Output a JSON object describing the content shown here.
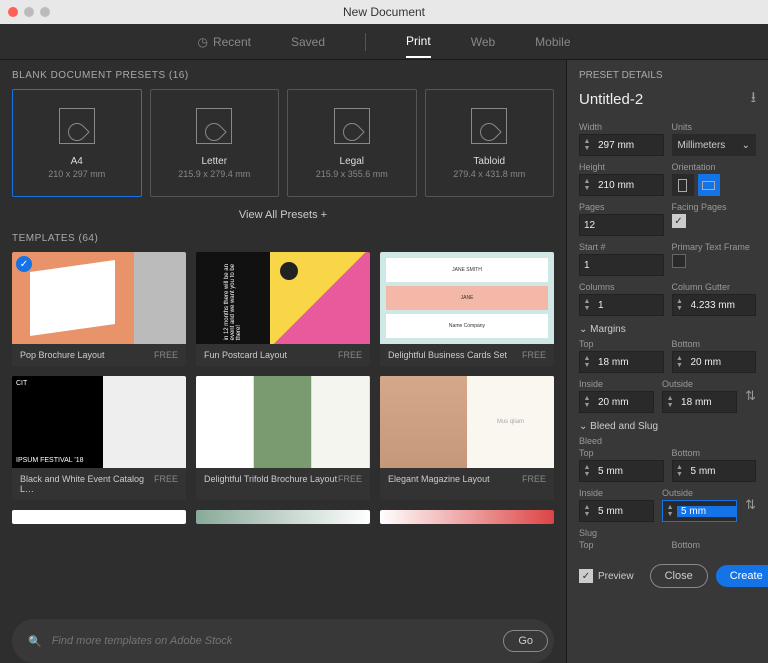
{
  "window": {
    "title": "New Document"
  },
  "tabs": {
    "recent": "Recent",
    "saved": "Saved",
    "print": "Print",
    "web": "Web",
    "mobile": "Mobile"
  },
  "presets_header": "BLANK DOCUMENT PRESETS  (16)",
  "presets": [
    {
      "name": "A4",
      "dim": "210 x 297 mm"
    },
    {
      "name": "Letter",
      "dim": "215.9 x 279.4 mm"
    },
    {
      "name": "Legal",
      "dim": "215.9 x 355.6 mm"
    },
    {
      "name": "Tabloid",
      "dim": "279.4 x 431.8 mm"
    }
  ],
  "view_all": "View All Presets  +",
  "templates_header": "TEMPLATES  (64)",
  "templates": [
    {
      "name": "Pop Brochure Layout",
      "price": "FREE"
    },
    {
      "name": "Fun Postcard Layout",
      "price": "FREE"
    },
    {
      "name": "Delightful Business Cards Set",
      "price": "FREE"
    },
    {
      "name": "Black and White Event Catalog L…",
      "price": "FREE"
    },
    {
      "name": "Delightful Trifold Brochure Layout",
      "price": "FREE"
    },
    {
      "name": "Elegant Magazine Layout",
      "price": "FREE"
    }
  ],
  "template_text": {
    "t2": "in 12 months there will be an event and we want you to be there!",
    "t3a": "JANE SMITH",
    "t3b": "JANE",
    "t3c": "Name Company",
    "t4a": "CIT",
    "t4b": "IPSUM FESTIVAL",
    "t4c": "'18",
    "t6": "Mus qliam"
  },
  "search": {
    "placeholder": "Find more templates on Adobe Stock",
    "go": "Go"
  },
  "details": {
    "header": "PRESET DETAILS",
    "doc_name": "Untitled-2",
    "width_label": "Width",
    "width": "297 mm",
    "units_label": "Units",
    "units": "Millimeters",
    "height_label": "Height",
    "height": "210 mm",
    "orientation_label": "Orientation",
    "pages_label": "Pages",
    "pages": "12",
    "facing_label": "Facing Pages",
    "start_label": "Start #",
    "start": "1",
    "primary_label": "Primary Text Frame",
    "columns_label": "Columns",
    "columns": "1",
    "gutter_label": "Column Gutter",
    "gutter": "4.233 mm",
    "margins_header": "Margins",
    "m_top_label": "Top",
    "m_top": "18 mm",
    "m_bottom_label": "Bottom",
    "m_bottom": "20 mm",
    "m_inside_label": "Inside",
    "m_inside": "20 mm",
    "m_outside_label": "Outside",
    "m_outside": "18 mm",
    "bleed_header": "Bleed and Slug",
    "bleed_label": "Bleed",
    "b_top_label": "Top",
    "b_top": "5 mm",
    "b_bottom_label": "Bottom",
    "b_bottom": "5 mm",
    "b_inside_label": "Inside",
    "b_inside": "5 mm",
    "b_outside_label": "Outside",
    "b_outside": "5 mm",
    "slug_label": "Slug",
    "s_top_label": "Top",
    "s_bottom_label": "Bottom",
    "preview": "Preview",
    "close": "Close",
    "create": "Create"
  }
}
